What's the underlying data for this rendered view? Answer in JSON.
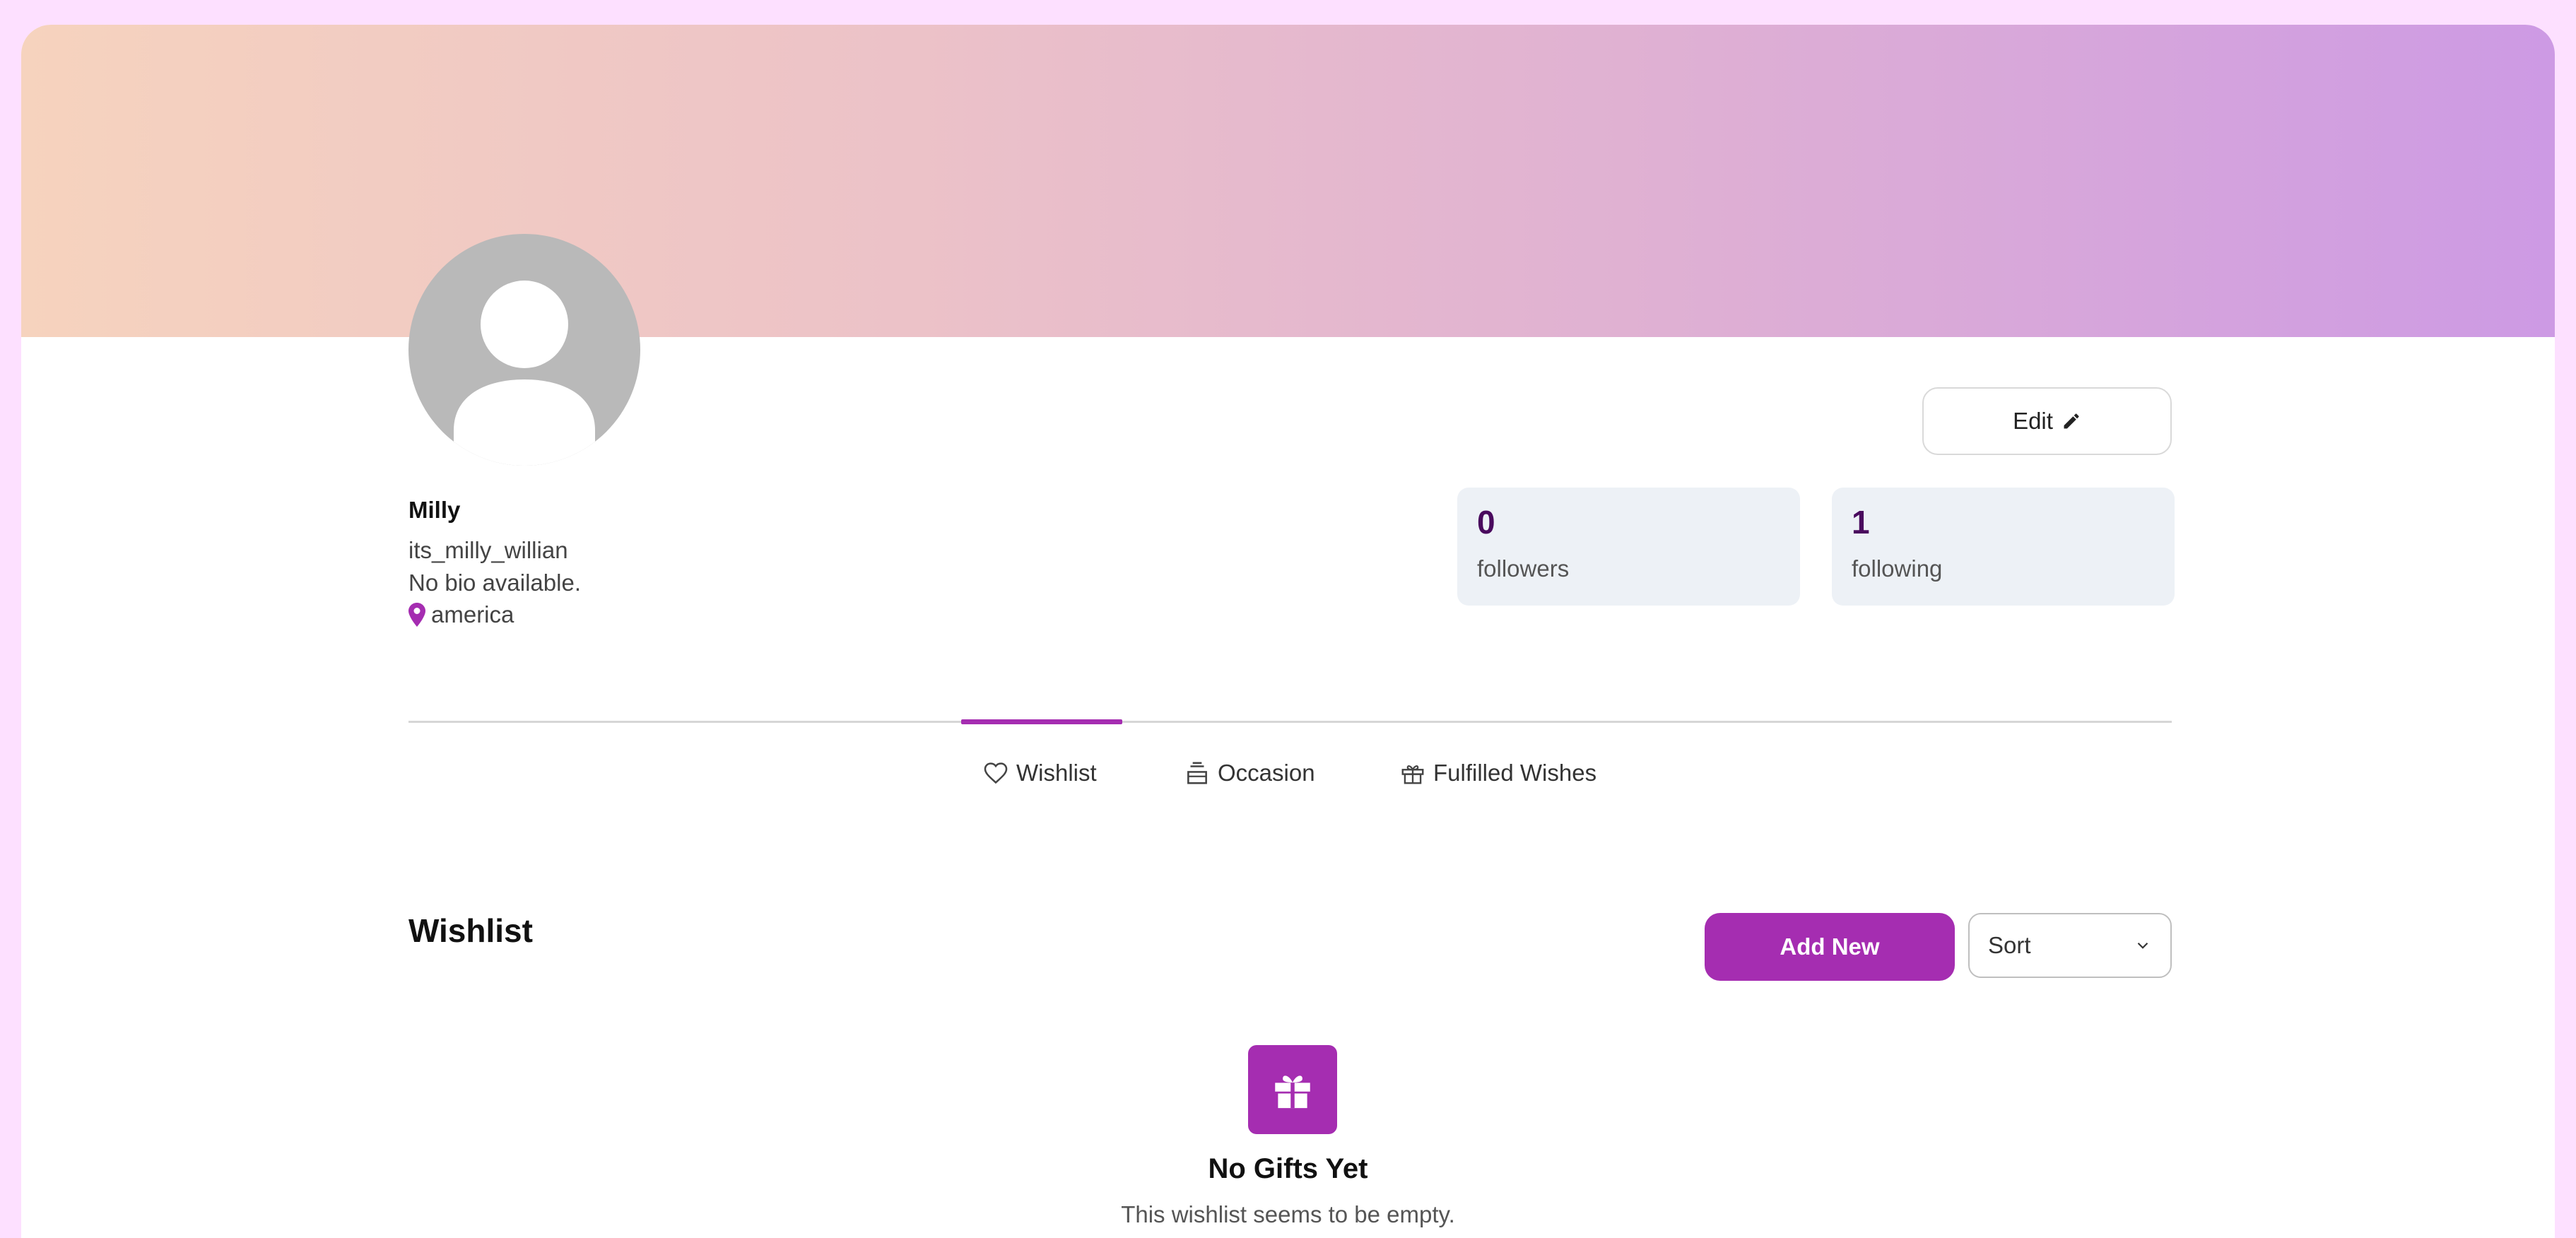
{
  "profile": {
    "name": "Milly",
    "username": "its_milly_willian",
    "bio": "No bio available.",
    "location": "america",
    "edit_label": "Edit"
  },
  "stats": {
    "followers": {
      "count": "0",
      "label": "followers"
    },
    "following": {
      "count": "1",
      "label": "following"
    }
  },
  "tabs": [
    {
      "label": "Wishlist",
      "icon": "heart-icon",
      "active": true
    },
    {
      "label": "Occasion",
      "icon": "cake-icon",
      "active": false
    },
    {
      "label": "Fulfilled Wishes",
      "icon": "gift-icon",
      "active": false
    }
  ],
  "wishlist": {
    "title": "Wishlist",
    "add_label": "Add New",
    "sort_label": "Sort",
    "empty_title": "No Gifts Yet",
    "empty_subtitle": "This wishlist seems to be empty."
  },
  "colors": {
    "accent": "#a52db1",
    "stat_number": "#4a0a5e",
    "card_bg": "#edf1f6"
  }
}
